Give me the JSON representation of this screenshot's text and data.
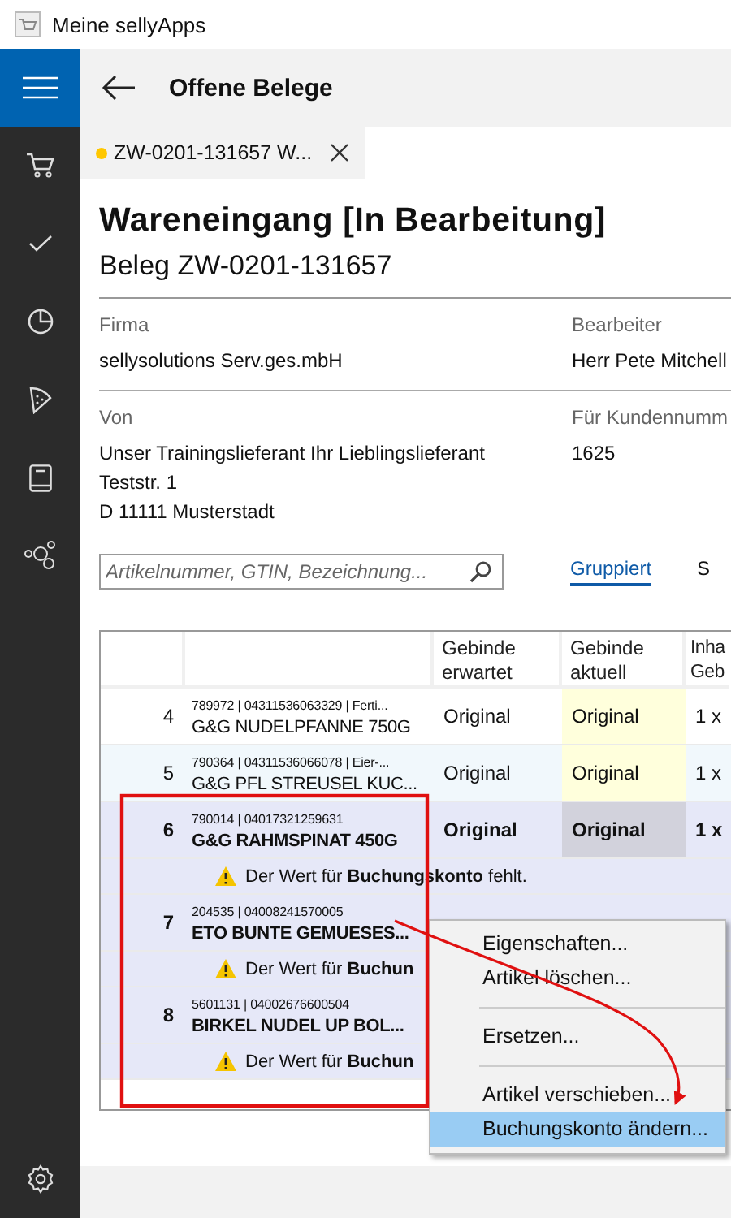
{
  "window": {
    "title": "Meine sellyApps"
  },
  "header": {
    "title": "Offene Belege"
  },
  "tabs": [
    {
      "label": "ZW-0201-131657 W...",
      "selected": true,
      "unsaved": true
    }
  ],
  "document": {
    "title": "Wareneingang [In Bearbeitung]",
    "subtitle": "Beleg ZW-0201-131657",
    "fields": [
      {
        "label": "Firma",
        "lines": [
          "sellysolutions Serv.ges.mbH"
        ],
        "label_2": "Bearbeiter",
        "lines_2": [
          "Herr Pete Mitchell"
        ]
      },
      {
        "label": "Von",
        "lines": [
          "Unser Trainingslieferant Ihr Lieblingslieferant",
          "Teststr. 1",
          "D 11111 Musterstadt"
        ],
        "label_2": "Für Kundennumm",
        "lines_2": [
          "1625"
        ]
      }
    ]
  },
  "search": {
    "placeholder": "Artikelnummer, GTIN, Bezeichnung..."
  },
  "view_links": [
    {
      "label": "Gruppiert",
      "selected": true
    },
    {
      "label": "S",
      "selected": false
    }
  ],
  "table": {
    "columns": [
      "",
      "",
      "Gebinde erwartet",
      "Gebinde aktuell",
      "Inha Geb"
    ],
    "rows": [
      {
        "number": "4",
        "codes": "789972 | 04311536063329 | Ferti...",
        "name": "G&G NUDELPFANNE 750G",
        "expected": "Original",
        "actual": "Original",
        "content": "1 x",
        "selected": false
      },
      {
        "number": "5",
        "codes": "790364 | 04311536066078 | Eier-...",
        "name": "G&G PFL STREUSEL KUC...",
        "expected": "Original",
        "actual": "Original",
        "content": "1 x",
        "selected": false
      },
      {
        "number": "6",
        "codes": "790014 | 04017321259631",
        "name": "G&G RAHMSPINAT 450G",
        "expected": "Original",
        "actual": "Original",
        "content": "1 x",
        "selected": true,
        "warning": "Der Wert für **Buchungskonto** fehlt."
      },
      {
        "number": "7",
        "codes": "204535 | 04008241570005",
        "name": "ETO BUNTE GEMUESES...",
        "selected": true,
        "warning": "Der Wert für **Buchun**"
      },
      {
        "number": "8",
        "codes": "5601131 | 04002676600504",
        "name": "BIRKEL NUDEL UP BOL...",
        "selected": true,
        "warning": "Der Wert für **Buchun**"
      }
    ]
  },
  "context_menu": {
    "items": [
      {
        "kind": "item",
        "label": "Eigenschaften...",
        "selected": false
      },
      {
        "kind": "item",
        "label": "Artikel löschen...",
        "selected": false
      },
      {
        "kind": "separator"
      },
      {
        "kind": "item",
        "label": "Ersetzen...",
        "selected": false
      },
      {
        "kind": "separator"
      },
      {
        "kind": "item",
        "label": "Artikel verschieben...",
        "selected": false
      },
      {
        "kind": "item",
        "label": "Buchungskonto ändern...",
        "selected": true
      }
    ]
  }
}
